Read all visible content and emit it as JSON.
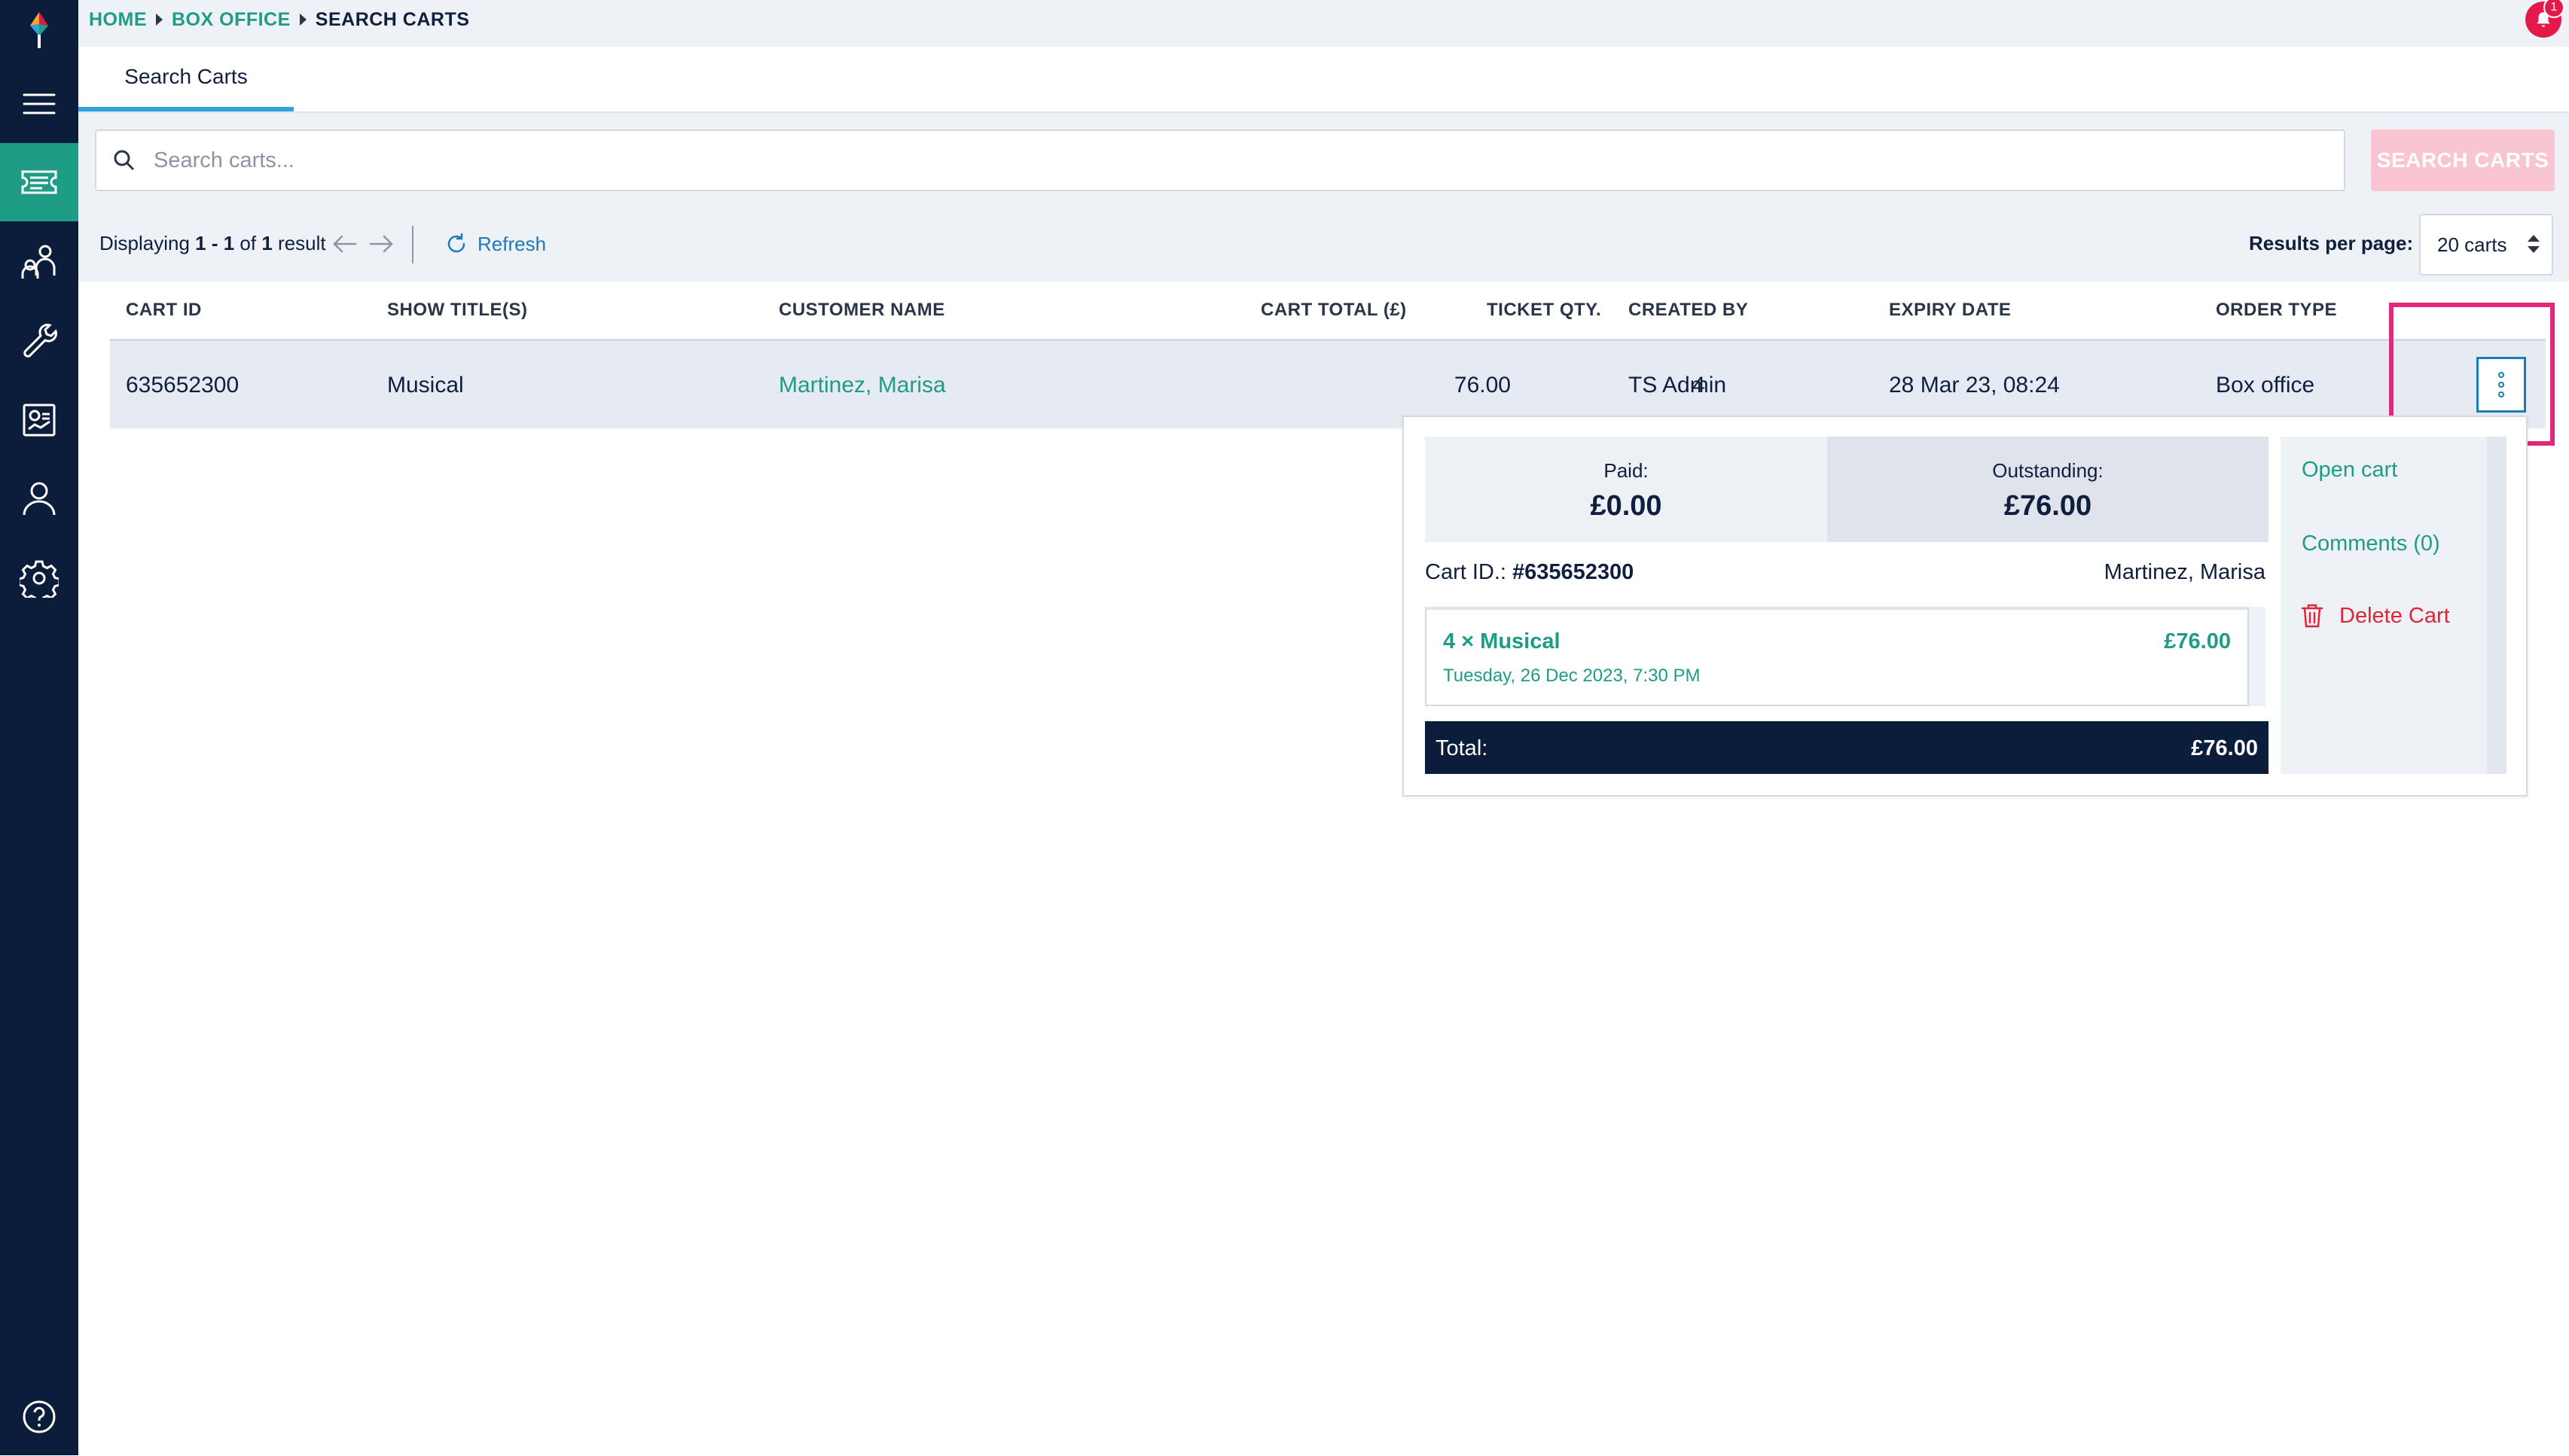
{
  "breadcrumb": {
    "home": "HOME",
    "section": "BOX OFFICE",
    "current": "SEARCH CARTS"
  },
  "tab": {
    "label": "Search Carts"
  },
  "notifications": {
    "count": "1"
  },
  "search": {
    "placeholder": "Search carts...",
    "button": "SEARCH CARTS"
  },
  "results": {
    "prefix": "Displaying ",
    "range": "1 - 1",
    "of": " of ",
    "total": "1",
    "suffix": " result",
    "refresh": "Refresh",
    "per_page_label": "Results per page:",
    "per_page_value": "20 carts"
  },
  "table": {
    "headers": [
      "CART ID",
      "SHOW TITLE(S)",
      "CUSTOMER NAME",
      "CART TOTAL (£)",
      "TICKET QTY.",
      "CREATED BY",
      "EXPIRY DATE",
      "ORDER TYPE"
    ],
    "rows": [
      {
        "cart_id": "635652300",
        "show": "Musical",
        "customer": "Martinez, Marisa",
        "total": "76.00",
        "qty": "4",
        "created_by": "TS Admin",
        "expiry": "28 Mar 23, 08:24",
        "order_type": "Box office"
      }
    ]
  },
  "popover": {
    "paid_label": "Paid:",
    "paid_value": "£0.00",
    "outstanding_label": "Outstanding:",
    "outstanding_value": "£76.00",
    "cart_id_label": "Cart ID.: ",
    "cart_id_value": "#635652300",
    "customer": "Martinez, Marisa",
    "item": {
      "title": "4 × Musical",
      "date": "Tuesday, 26 Dec 2023, 7:30 PM",
      "price": "£76.00"
    },
    "total_label": "Total:",
    "total_value": "£76.00",
    "actions": {
      "open": "Open cart",
      "comments": "Comments (0)",
      "delete": "Delete Cart"
    }
  },
  "colors": {
    "sidebar": "#0c1d3c",
    "accent_green": "#1f9c86",
    "accent_blue": "#1f7bb8",
    "highlight": "#e4267c",
    "danger": "#e0243a"
  },
  "icons": {
    "sidebar": [
      "logo-icon",
      "menu-icon",
      "ticket-icon",
      "user-network-icon",
      "wrench-icon",
      "report-icon",
      "person-icon",
      "gear-icon",
      "help-icon"
    ]
  }
}
